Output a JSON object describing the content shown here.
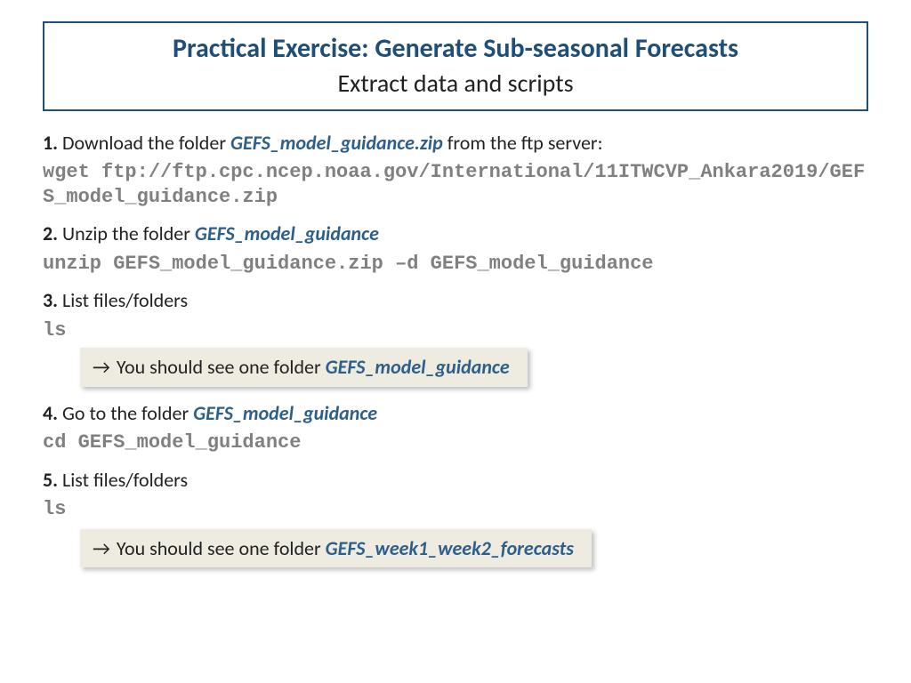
{
  "title": {
    "main": "Practical Exercise: Generate Sub-seasonal Forecasts",
    "sub": "Extract data and scripts"
  },
  "steps": [
    {
      "num": "1.",
      "before": " Download the folder ",
      "emph": "GEFS_model_guidance.zip",
      "after": " from the ftp server:",
      "cmd": "wget ftp://ftp.cpc.ncep.noaa.gov/International/11ITWCVP_Ankara2019/GEFS_model_guidance.zip"
    },
    {
      "num": "2.",
      "before": " Unzip the folder ",
      "emph": "GEFS_model_guidance",
      "after": "",
      "cmd": "unzip GEFS_model_guidance.zip –d GEFS_model_guidance"
    },
    {
      "num": "3.",
      "before": " List files/folders",
      "emph": "",
      "after": "",
      "cmd": "ls",
      "note_before": " You should see one folder ",
      "note_emph": "GEFS_model_guidance"
    },
    {
      "num": "4.",
      "before": " Go to the folder ",
      "emph": "GEFS_model_guidance",
      "after": "",
      "cmd": "cd GEFS_model_guidance"
    },
    {
      "num": "5.",
      "before": " List files/folders",
      "emph": "",
      "after": "",
      "cmd": "ls",
      "note_before": " You should see one folder ",
      "note_emph": "GEFS_week1_week2_forecasts"
    }
  ],
  "arrow": "→"
}
